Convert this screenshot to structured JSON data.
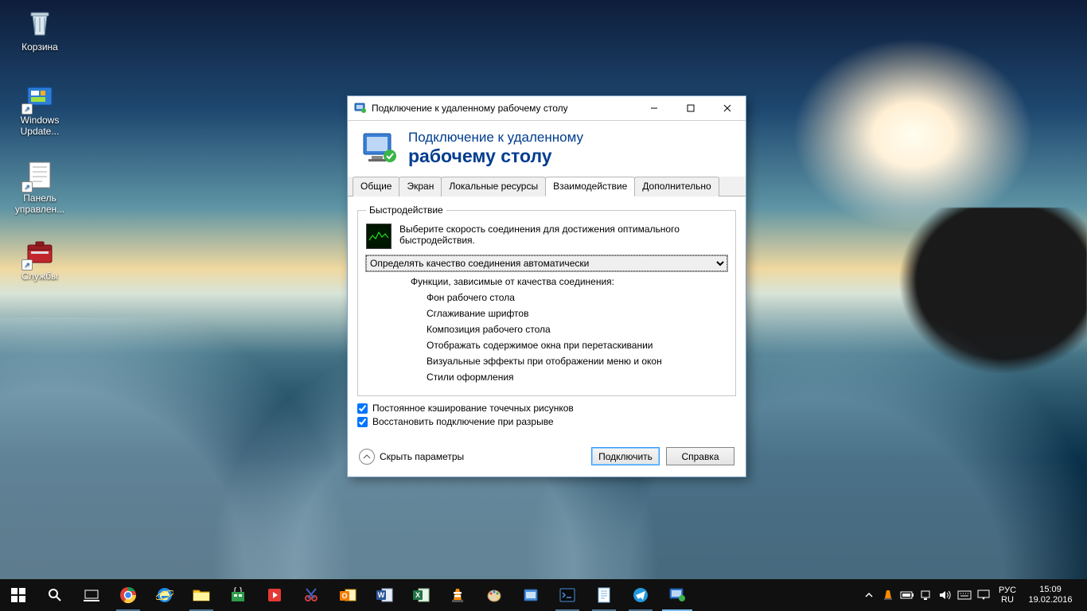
{
  "desktop": {
    "icons": [
      {
        "label": "Корзина",
        "icon": "recycle-bin",
        "shortcut": false
      },
      {
        "label": "Windows Update...",
        "icon": "windows-update",
        "shortcut": true
      },
      {
        "label": "Панель управлен...",
        "icon": "control-panel",
        "shortcut": true
      },
      {
        "label": "Службы",
        "icon": "services",
        "shortcut": true
      }
    ]
  },
  "dialog": {
    "window_title": "Подключение к удаленному рабочему столу",
    "banner_line1": "Подключение к удаленному",
    "banner_line2": "рабочему столу",
    "tabs": [
      "Общие",
      "Экран",
      "Локальные ресурсы",
      "Взаимодействие",
      "Дополнительно"
    ],
    "active_tab_index": 3,
    "group_title": "Быстродействие",
    "info_text": "Выберите скорость соединения для достижения оптимального быстродействия.",
    "speed_selected": "Определять качество соединения автоматически",
    "features_header": "Функции, зависимые от качества соединения:",
    "features": [
      "Фон рабочего стола",
      "Сглаживание шрифтов",
      "Композиция рабочего стола",
      "Отображать содержимое окна при перетаскивании",
      "Визуальные эффекты при отображении меню и окон",
      "Стили оформления"
    ],
    "checkbox_cache": "Постоянное кэширование точечных рисунков",
    "checkbox_reconnect": "Восстановить подключение при разрыве",
    "checkbox_cache_checked": true,
    "checkbox_reconnect_checked": true,
    "hide_options": "Скрыть параметры",
    "btn_connect": "Подключить",
    "btn_help": "Справка"
  },
  "taskbar": {
    "lang_short": "РУС",
    "lang_code": "RU",
    "time": "15:09",
    "date": "19.02.2016"
  }
}
